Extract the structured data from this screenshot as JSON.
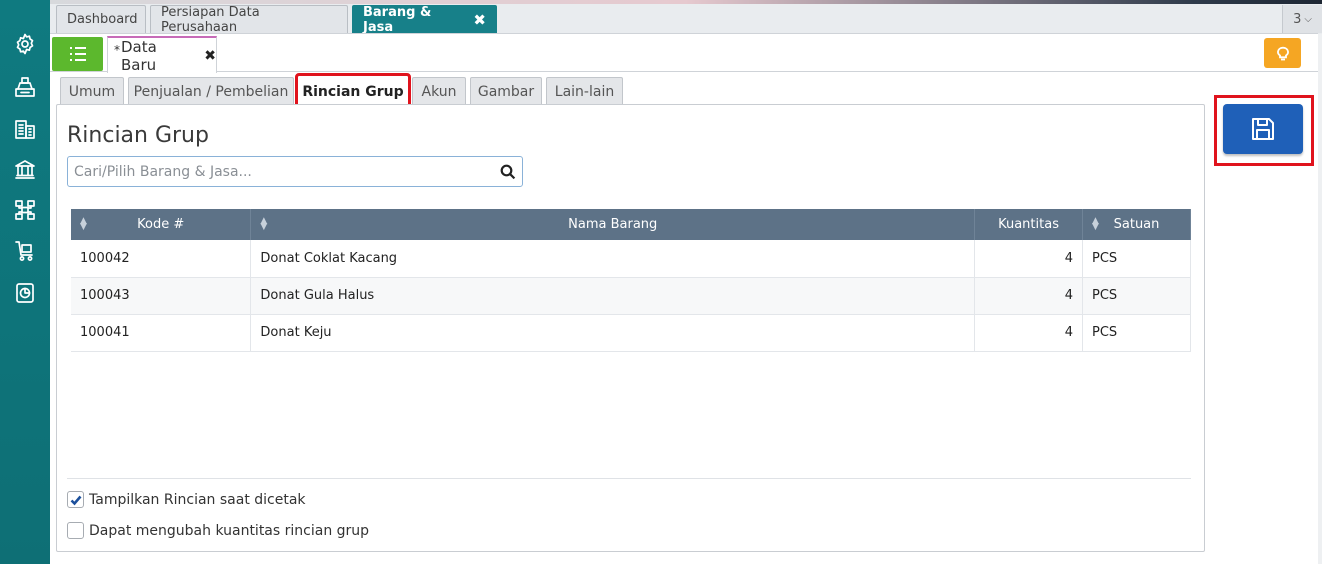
{
  "top_tabs": [
    {
      "label": "Dashboard"
    },
    {
      "label": "Persiapan Data Perusahaan"
    },
    {
      "label": "Barang & Jasa",
      "active": true
    }
  ],
  "top_right_count": "3",
  "doc_tab": {
    "modified_marker": "*",
    "label": "Data Baru"
  },
  "inner_tabs": [
    {
      "label": "Umum"
    },
    {
      "label": "Penjualan / Pembelian"
    },
    {
      "label": "Rincian Grup",
      "active": true
    },
    {
      "label": "Akun"
    },
    {
      "label": "Gambar"
    },
    {
      "label": "Lain-lain"
    }
  ],
  "section_title": "Rincian Grup",
  "search": {
    "placeholder": "Cari/Pilih Barang & Jasa...",
    "value": ""
  },
  "table": {
    "columns": [
      "Kode #",
      "Nama Barang",
      "Kuantitas",
      "Satuan"
    ],
    "rows": [
      {
        "kode": "100042",
        "nama": "Donat Coklat Kacang",
        "qty": "4",
        "satuan": "PCS"
      },
      {
        "kode": "100043",
        "nama": "Donat Gula Halus",
        "qty": "4",
        "satuan": "PCS"
      },
      {
        "kode": "100041",
        "nama": "Donat Keju",
        "qty": "4",
        "satuan": "PCS"
      }
    ]
  },
  "options": [
    {
      "label": "Tampilkan Rincian saat dicetak",
      "checked": true
    },
    {
      "label": "Dapat mengubah kuantitas rincian grup",
      "checked": false
    }
  ],
  "sidebar_icons": [
    "gear-icon",
    "cash-register-icon",
    "building-icon",
    "bank-icon",
    "network-icon",
    "cart-icon",
    "report-icon"
  ],
  "colors": {
    "primary": "#1f60b8",
    "teal": "#178089",
    "green": "#5cb82d",
    "warning": "#f5a623",
    "highlight": "#e0131d"
  }
}
